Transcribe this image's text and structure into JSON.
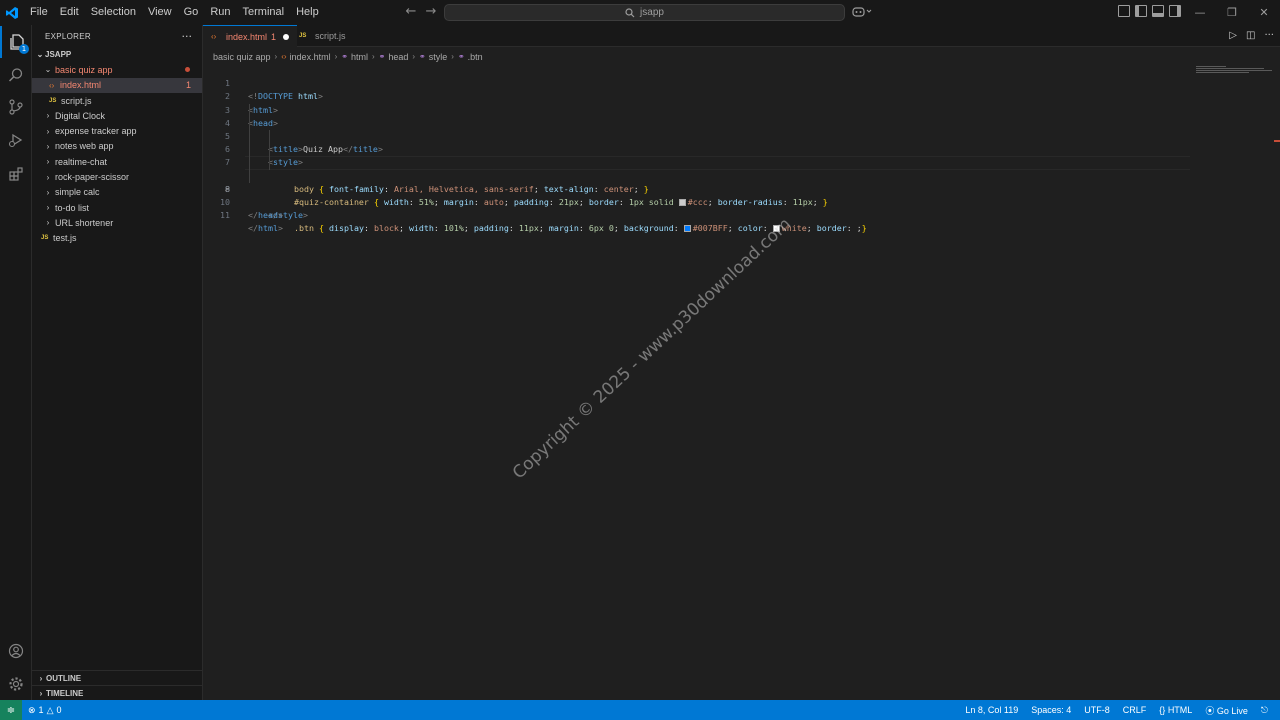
{
  "titlebar": {
    "menu": [
      "File",
      "Edit",
      "Selection",
      "View",
      "Go",
      "Run",
      "Terminal",
      "Help"
    ],
    "search": "jsapp"
  },
  "sidebar": {
    "title": "EXPLORER",
    "root": "JSAPP",
    "items": [
      {
        "label": "basic quiz app",
        "type": "folder-open",
        "depth": 1
      },
      {
        "label": "index.html",
        "type": "html",
        "depth": 2,
        "count": "1"
      },
      {
        "label": "script.js",
        "type": "js",
        "depth": 2
      },
      {
        "label": "Digital Clock",
        "type": "folder",
        "depth": 1
      },
      {
        "label": "expense tracker app",
        "type": "folder",
        "depth": 1
      },
      {
        "label": "notes web app",
        "type": "folder",
        "depth": 1
      },
      {
        "label": "realtime-chat",
        "type": "folder",
        "depth": 1
      },
      {
        "label": "rock-paper-scissor",
        "type": "folder",
        "depth": 1
      },
      {
        "label": "simple calc",
        "type": "folder",
        "depth": 1
      },
      {
        "label": "to-do list",
        "type": "folder",
        "depth": 1
      },
      {
        "label": "URL shortener",
        "type": "folder",
        "depth": 1
      },
      {
        "label": "test.js",
        "type": "js",
        "depth": 0
      }
    ],
    "outline": "OUTLINE",
    "timeline": "TIMELINE"
  },
  "tabs": [
    {
      "label": "index.html",
      "count": "1",
      "active": true
    },
    {
      "label": "script.js",
      "active": false
    }
  ],
  "breadcrumb": [
    "basic quiz app",
    "index.html",
    "html",
    "head",
    "style",
    ".btn"
  ],
  "editor": {
    "current_line": 8,
    "lines": [
      "1",
      "2",
      "3",
      "4",
      "5",
      "6",
      "7",
      "8",
      "9",
      "10",
      "11"
    ],
    "code": {
      "l1_a": "<!",
      "l1_b": "DOCTYPE",
      "l1_c": " html",
      "l1_d": ">",
      "l2": "html",
      "l3": "head",
      "l4_tag": "title",
      "l4_text": "Quiz App",
      "l5": "style",
      "l6_sel": "body",
      "l6_p1": "font-family",
      "l6_v1": "Arial, Helvetica, sans-serif",
      "l6_p2": "text-align",
      "l6_v2": "center",
      "l7_sel": "#quiz-container",
      "l7_p1": "width",
      "l7_v1": "51%",
      "l7_p2": "margin",
      "l7_v2": "auto",
      "l7_p3": "padding",
      "l7_v3": "21px",
      "l7_p4": "border",
      "l7_v4a": "1px solid ",
      "l7_v4b": "#ccc",
      "l7_p5": "border-radius",
      "l7_v5": "11px",
      "l8_sel": ".btn",
      "l8_p1": "display",
      "l8_v1": "block",
      "l8_p2": "width",
      "l8_v2": "101%",
      "l8_p3": "padding",
      "l8_v3": "11px",
      "l8_p4": "margin",
      "l8_v4": "6px 0",
      "l8_p5": "background",
      "l8_v5": "#007BFF",
      "l8_p6": "color",
      "l8_v6": "white",
      "l8_p7": "border",
      "l9": "style",
      "l10": "head",
      "l11": "html"
    },
    "swatches": {
      "ccc": "#cccccc",
      "blue": "#007bff",
      "white": "#ffffff"
    }
  },
  "watermark": "Copyright © 2025 - www.p30download.com",
  "statusbar": {
    "errors": "1",
    "warnings": "0",
    "position": "Ln 8, Col 119",
    "spaces": "Spaces: 4",
    "encoding": "UTF-8",
    "eol": "CRLF",
    "language": "HTML",
    "golive": "Go Live"
  },
  "colors": {
    "accent": "#0078d4",
    "error": "#f48771"
  }
}
